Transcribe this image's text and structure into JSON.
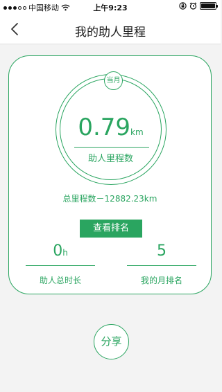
{
  "status_bar": {
    "carrier": "中国移动",
    "time": "上午9:23",
    "signal_icon": "signal-dots-icon",
    "wifi_icon": "wifi-icon",
    "orientation_lock_icon": "orientation-lock-icon",
    "alarm_icon": "alarm-icon",
    "battery_icon": "battery-icon"
  },
  "navbar": {
    "title": "我的助人里程",
    "back_icon": "chevron-left-icon"
  },
  "summary": {
    "period_badge": "当月",
    "monthly_value": "0.79",
    "monthly_unit": "km",
    "monthly_label": "助人里程数",
    "total_text": "总里程数－12882.23km",
    "rank_button": "查看排名"
  },
  "stats": {
    "hours_value": "0",
    "hours_unit": "h",
    "hours_label": "助人总时长",
    "rank_value": "5",
    "rank_label": "我的月排名"
  },
  "share": {
    "label": "分享"
  },
  "colors": {
    "accent": "#2aa560",
    "background": "#f3f3f3",
    "card_background": "#ffffff"
  }
}
